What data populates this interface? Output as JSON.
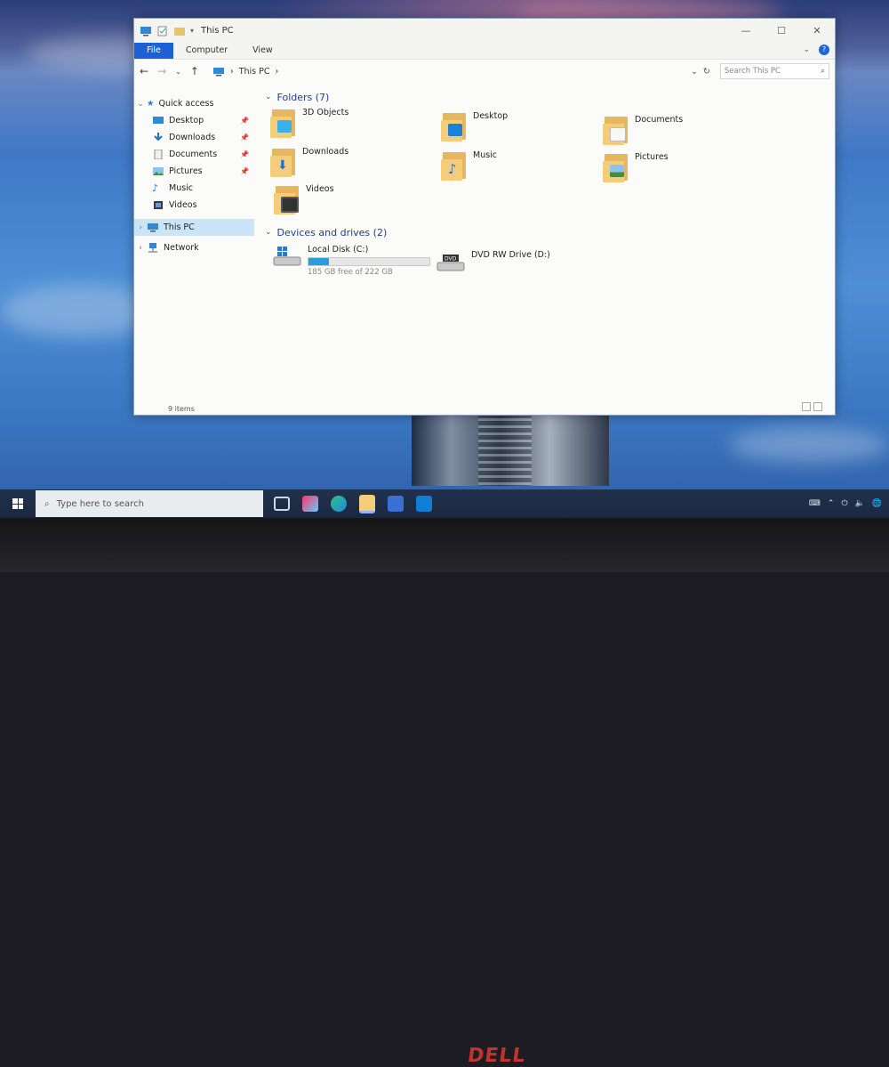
{
  "window": {
    "title": "This PC",
    "ribbon_tabs": [
      "File",
      "Computer",
      "View"
    ],
    "address_path": "This PC",
    "search_placeholder": "Search This PC",
    "status_text": "9 items"
  },
  "nav_pane": {
    "quick_access_label": "Quick access",
    "quick_access_items": [
      {
        "label": "Desktop",
        "icon": "desktop-icon",
        "pinned": true
      },
      {
        "label": "Downloads",
        "icon": "download-arrow-icon",
        "pinned": true
      },
      {
        "label": "Documents",
        "icon": "documents-icon",
        "pinned": true
      },
      {
        "label": "Pictures",
        "icon": "pictures-icon",
        "pinned": true
      },
      {
        "label": "Music",
        "icon": "music-note-icon",
        "pinned": false
      },
      {
        "label": "Videos",
        "icon": "videos-icon",
        "pinned": false
      }
    ],
    "this_pc_label": "This PC",
    "network_label": "Network"
  },
  "content": {
    "folders_header": "Folders (7)",
    "folders": [
      {
        "label": "3D Objects",
        "icon": "3d-objects-folder-icon"
      },
      {
        "label": "Desktop",
        "icon": "desktop-folder-icon"
      },
      {
        "label": "Documents",
        "icon": "documents-folder-icon"
      },
      {
        "label": "Downloads",
        "icon": "downloads-folder-icon"
      },
      {
        "label": "Music",
        "icon": "music-folder-icon"
      },
      {
        "label": "Pictures",
        "icon": "pictures-folder-icon"
      },
      {
        "label": "Videos",
        "icon": "videos-folder-icon"
      }
    ],
    "drives_header": "Devices and drives (2)",
    "drives": [
      {
        "label": "Local Disk (C:)",
        "free_text": "185 GB free of 222 GB",
        "used_fraction": 0.167,
        "icon": "windows-drive-icon"
      },
      {
        "label": "DVD RW Drive (D:)",
        "icon": "dvd-drive-icon"
      }
    ]
  },
  "taskbar": {
    "search_placeholder": "Type here to search"
  },
  "bezel": {
    "brand": "DELL"
  },
  "colors": {
    "accent": "#1d5fd4",
    "selection": "#cce4f7",
    "drive_bar": "#26a0da",
    "folder": "#f3cd7a"
  }
}
